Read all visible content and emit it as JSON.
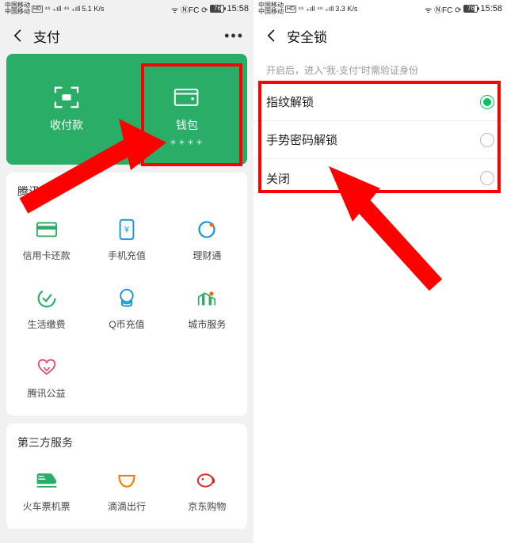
{
  "status": {
    "carrier_line1": "中国移动",
    "carrier_line2": "中国移动",
    "hd": "HD",
    "sig": "⁴⁶ ₊ıll ⁴⁶ ₊ıll",
    "speed1": "5.1",
    "speed1_unit": "K/s",
    "speed2": "3.3",
    "speed2_unit": "K/s",
    "icons": "ᯤ ⓃFC ⟳",
    "nfc": "N",
    "vib": "▮◗▮",
    "battery_pct": "76",
    "time": "15:58"
  },
  "left": {
    "title": "支付",
    "hero": {
      "pay_label": "收付款",
      "wallet_label": "钱包",
      "wallet_sub": "＊＊＊＊"
    },
    "sections": {
      "tencent": {
        "title": "腾讯服务",
        "items": [
          {
            "label": "信用卡还款"
          },
          {
            "label": "手机充值"
          },
          {
            "label": "理财通"
          },
          {
            "label": "生活缴费"
          },
          {
            "label": "Q币充值"
          },
          {
            "label": "城市服务"
          },
          {
            "label": "腾讯公益"
          }
        ]
      },
      "third": {
        "title": "第三方服务",
        "items": [
          {
            "label": "火车票机票"
          },
          {
            "label": "滴滴出行"
          },
          {
            "label": "京东购物"
          }
        ]
      }
    }
  },
  "right": {
    "title": "安全锁",
    "hint": "开启后，进入“我-支付”时需验证身份",
    "options": [
      {
        "label": "指纹解锁",
        "selected": true
      },
      {
        "label": "手势密码解锁",
        "selected": false
      },
      {
        "label": "关闭",
        "selected": false
      }
    ]
  },
  "colors": {
    "accent": "#07c160",
    "hero_bg": "#2aae67",
    "annotation": "#ff0000"
  }
}
